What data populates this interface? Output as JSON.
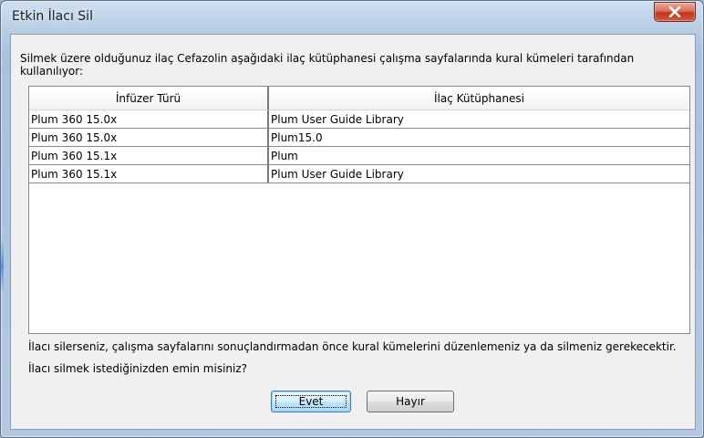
{
  "window": {
    "title": "Etkin İlacı Sil",
    "close_icon": "close-x-icon"
  },
  "dialog": {
    "message": "Silmek üzere olduğunuz ilaç Cefazolin aşağıdaki ilaç kütüphanesi çalışma sayfalarında kural kümeleri tarafından kullanılıyor:",
    "table": {
      "columns": [
        "İnfüzer Türü",
        "İlaç Kütüphanesi"
      ],
      "rows": [
        [
          "Plum 360 15.0x",
          "Plum User Guide Library"
        ],
        [
          "Plum 360 15.0x",
          "Plum15.0"
        ],
        [
          "Plum 360 15.1x",
          "Plum"
        ],
        [
          "Plum 360 15.1x",
          "Plum User Guide Library"
        ]
      ]
    },
    "warning": "İlacı silerseniz, çalışma sayfalarını sonuçlandırmadan önce kural kümelerini düzenlemeniz ya da silmeniz gerekecektir.",
    "question": "İlacı silmek istediğinizden emin misiniz?",
    "buttons": {
      "yes": "Evet",
      "no": "Hayır"
    }
  }
}
